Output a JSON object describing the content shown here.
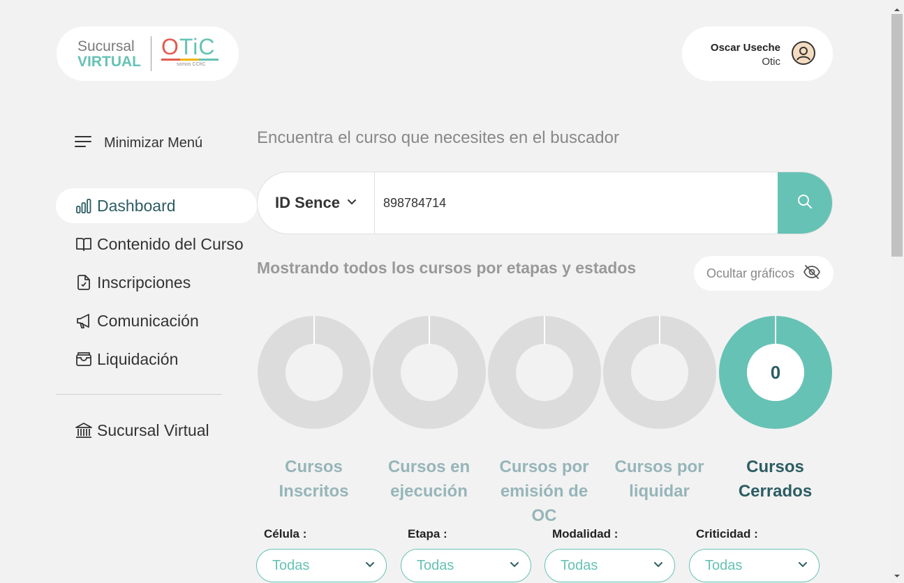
{
  "logo": {
    "line1": "Sucursal",
    "line2": "VIRTUAL",
    "brand_o": "O",
    "brand_rest": "TiC",
    "brand_sub": "somos CChC"
  },
  "user": {
    "name": "Oscar Useche",
    "org": "Otic"
  },
  "sidebar": {
    "toggle_label": "Minimizar Menú",
    "items": [
      {
        "label": "Dashboard",
        "icon": "chart-bars-icon",
        "active": true
      },
      {
        "label": "Contenido del Curso",
        "icon": "book-icon"
      },
      {
        "label": "Inscripciones",
        "icon": "file-check-icon"
      },
      {
        "label": "Comunicación",
        "icon": "megaphone-icon"
      },
      {
        "label": "Liquidación",
        "icon": "wallet-icon"
      }
    ],
    "bottom_item": {
      "label": "Sucursal Virtual",
      "icon": "bank-icon"
    }
  },
  "search": {
    "title": "Encuentra el curso que necesites en el buscador",
    "select_label": "ID Sence",
    "value": "898784714"
  },
  "stats": {
    "title": "Mostrando todos los cursos por etapas y estados",
    "hide_label": "Ocultar gráficos",
    "items": [
      {
        "line1": "Cursos",
        "line2": "Inscritos",
        "value": "",
        "active": false
      },
      {
        "line1": "Cursos en",
        "line2": "ejecución",
        "value": "",
        "active": false
      },
      {
        "line1": "Cursos por",
        "line2": "emisión de OC",
        "value": "",
        "active": false
      },
      {
        "line1": "Cursos por",
        "line2": "liquidar",
        "value": "",
        "active": false
      },
      {
        "line1": "Cursos",
        "line2": "Cerrados",
        "value": "0",
        "active": true
      }
    ]
  },
  "filters": [
    {
      "label": "Célula :",
      "value": "Todas"
    },
    {
      "label": "Etapa :",
      "value": "Todas"
    },
    {
      "label": "Modalidad :",
      "value": "Todas"
    },
    {
      "label": "Criticidad :",
      "value": "Todas"
    }
  ],
  "colors": {
    "accent": "#66c2b4",
    "dark_teal": "#2c5d63",
    "muted_teal": "#96b5b9",
    "inactive_donut": "#dcdcdc"
  }
}
